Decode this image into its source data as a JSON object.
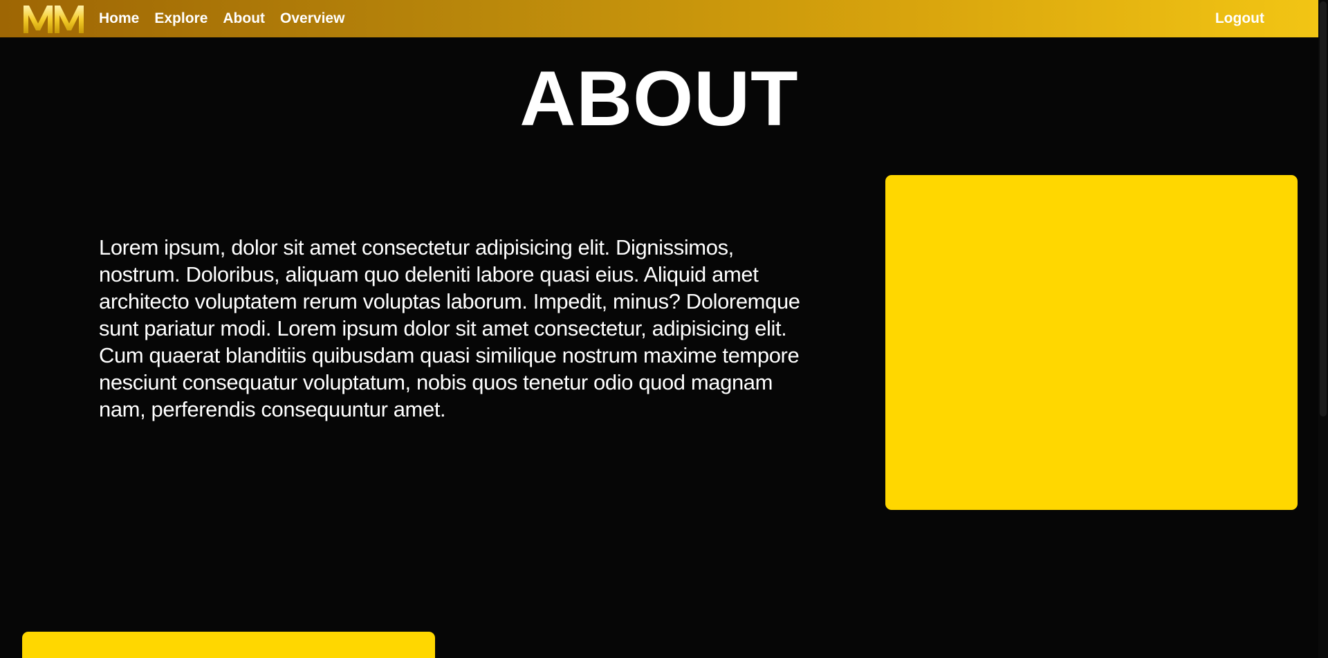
{
  "navbar": {
    "logo_text": "MM",
    "links": [
      {
        "label": "Home"
      },
      {
        "label": "Explore"
      },
      {
        "label": "About"
      },
      {
        "label": "Overview"
      }
    ],
    "logout_label": "Logout"
  },
  "main": {
    "title": "ABOUT",
    "paragraph": "Lorem ipsum, dolor sit amet consectetur adipisicing elit. Dignissimos, nostrum. Doloribus, aliquam quo deleniti labore quasi eius. Aliquid amet architecto voluptatem rerum voluptas laborum. Impedit, minus? Doloremque sunt pariatur modi. Lorem ipsum dolor sit amet consectetur, adipisicing elit. Cum quaerat blanditiis quibusdam quasi similique nostrum maxime tempore nesciunt consequatur voluptatum, nobis quos tenetur odio quod magnam nam, perferendis consequuntur amet."
  },
  "colors": {
    "background": "#060606",
    "accent": "#ffd700",
    "nav_gradient_start": "#9e6604",
    "nav_gradient_end": "#f2c514",
    "text": "#ffffff"
  },
  "icons": {
    "logo": "mm-logo-icon"
  }
}
